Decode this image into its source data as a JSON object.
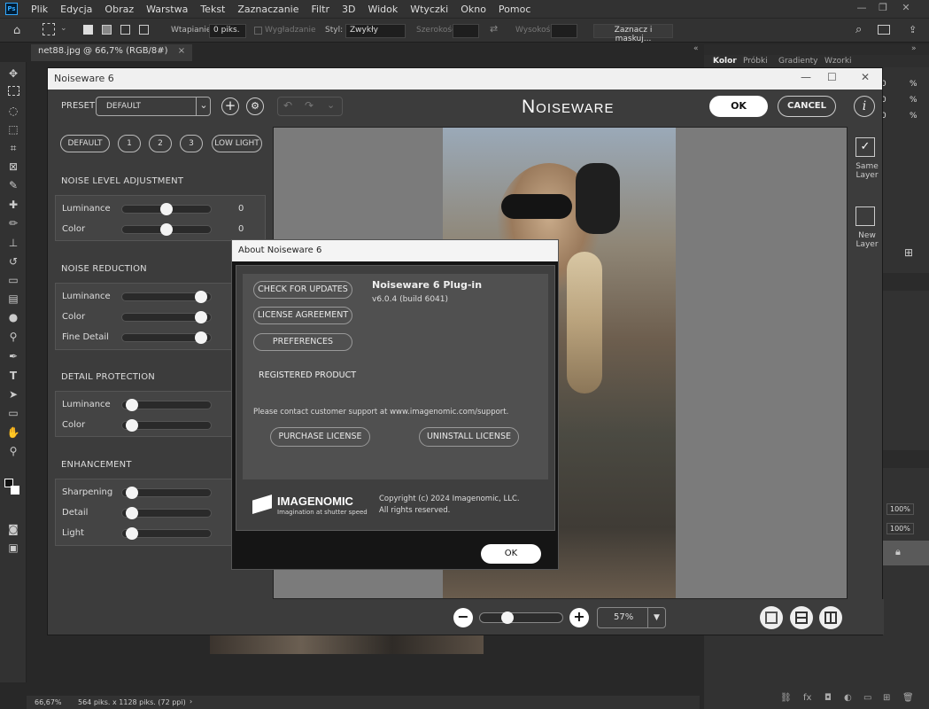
{
  "menubar": {
    "logo": "Ps",
    "items": [
      "Plik",
      "Edycja",
      "Obraz",
      "Warstwa",
      "Tekst",
      "Zaznaczanie",
      "Filtr",
      "3D",
      "Widok",
      "Wtyczki",
      "Okno",
      "Pomoc"
    ]
  },
  "optbar": {
    "feather_label": "Wtapianie:",
    "feather_value": "0 piks.",
    "smooth_label": "Wygładzanie",
    "style_label": "Styl:",
    "style_value": "Zwykły",
    "width_label": "Szerokość:",
    "height_label": "Wysokość:",
    "select_mask_button": "Zaznacz i maskuj..."
  },
  "document": {
    "tab_title": "net88.jpg @ 66,7% (RGB/8#)",
    "tab_close": "×"
  },
  "statusbar": {
    "zoom": "66,67%",
    "info": "564 piks. x 1128 piks. (72 ppi)",
    "arrow": "›"
  },
  "right_panels": {
    "tabs": [
      "Kolor",
      "Próbki",
      "Gradienty",
      "Wzorki"
    ],
    "percent_1": "%",
    "percent_2": "%",
    "percent_3": "%",
    "zero_1": "0",
    "zero_2": "0",
    "zero_3": "0",
    "opacity_1": "100%",
    "opacity_2": "100%"
  },
  "noiseware": {
    "window_title": "Noiseware 6",
    "logo_text": "Noiseware",
    "preset_label": "PRESET",
    "preset_value": "DEFAULT",
    "ok_label": "OK",
    "cancel_label": "CANCEL",
    "info_label": "i",
    "preset_buttons": [
      "DEFAULT",
      "1",
      "2",
      "3",
      "LOW LIGHT"
    ],
    "sections": {
      "noise_level": {
        "title": "NOISE LEVEL ADJUSTMENT",
        "rows": [
          {
            "label": "Luminance",
            "value": "0",
            "level": 0.5
          },
          {
            "label": "Color",
            "value": "0",
            "level": 0.5
          }
        ]
      },
      "noise_reduction": {
        "title": "NOISE REDUCTION",
        "rows": [
          {
            "label": "Luminance",
            "level": 0.95
          },
          {
            "label": "Color",
            "level": 0.95
          },
          {
            "label": "Fine Detail",
            "level": 0.95
          }
        ]
      },
      "detail_protection": {
        "title": "DETAIL PROTECTION",
        "rows": [
          {
            "label": "Luminance",
            "level": 0.05
          },
          {
            "label": "Color",
            "level": 0.05
          }
        ]
      },
      "enhancement": {
        "title": "ENHANCEMENT",
        "rows": [
          {
            "label": "Sharpening",
            "level": 0.05
          },
          {
            "label": "Detail",
            "level": 0.05
          },
          {
            "label": "Light",
            "level": 0.05
          }
        ]
      }
    },
    "right_tools": {
      "same_layer": "Same Layer",
      "new_layer": "New Layer"
    },
    "zoom_value": "57%",
    "zoom_level": 0.3
  },
  "about": {
    "title": "About Noiseware 6",
    "check_updates": "CHECK FOR UPDATES",
    "license_agreement": "LICENSE AGREEMENT",
    "preferences": "PREFERENCES",
    "product_name": "Noiseware 6 Plug-in",
    "version": "v6.0.4 (build 6041)",
    "registered": "REGISTERED PRODUCT",
    "support_text": "Please contact customer support at www.imagenomic.com/support.",
    "purchase": "PURCHASE LICENSE",
    "uninstall": "UNINSTALL LICENSE",
    "brand": "IMAGENOMIC",
    "tagline": "Imagination at shutter speed",
    "copyright": "Copyright (c) 2024 Imagenomic, LLC.",
    "rights": "All rights reserved.",
    "ok": "OK"
  }
}
